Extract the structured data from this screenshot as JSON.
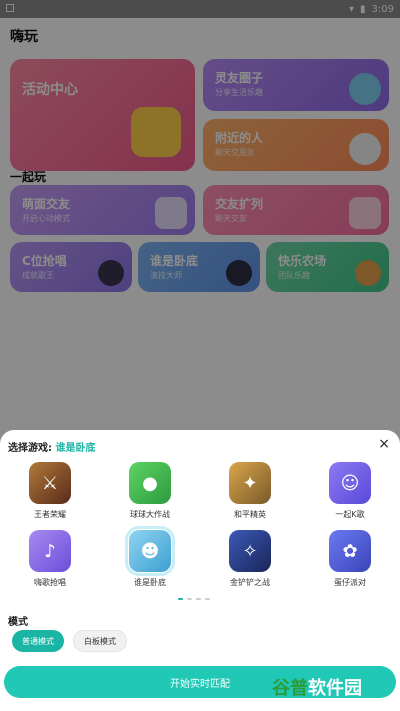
{
  "status": {
    "time": "3:09"
  },
  "page": {
    "title": "嗨玩",
    "section_play": "一起玩",
    "cards": {
      "activity": {
        "title": "活动中心"
      },
      "soul": {
        "title": "灵友圈子",
        "sub": "分享生活乐趣"
      },
      "nearby": {
        "title": "附近的人",
        "sub": "聊天交朋友"
      },
      "voice": {
        "title": "萌面交友",
        "sub": "开启心动模式"
      },
      "expand": {
        "title": "交友扩列",
        "sub": "聊天交友"
      },
      "cpos": {
        "title": "C位抢唱",
        "sub": "成就歌王"
      },
      "spy": {
        "title": "谁是卧底",
        "sub": "演技大师"
      },
      "farm": {
        "title": "快乐农场",
        "sub": "团队乐趣"
      }
    }
  },
  "sheet": {
    "label_prefix": "选择游戏:",
    "selected_game": "谁是卧底",
    "close_icon": "×",
    "games": [
      {
        "label": "王者荣耀",
        "color": "#7a4b2a"
      },
      {
        "label": "球球大作战",
        "color": "#3cb24a"
      },
      {
        "label": "和平精英",
        "color": "#b88a3c"
      },
      {
        "label": "一起K歌",
        "color": "#6a58e8"
      },
      {
        "label": "嗨歌抢唱",
        "color": "#7b5ad9"
      },
      {
        "label": "谁是卧底",
        "color": "#4fb7e2"
      },
      {
        "label": "金铲铲之战",
        "color": "#2a3c8c"
      },
      {
        "label": "蛋仔派对",
        "color": "#4a5ad0"
      }
    ],
    "mode_title": "模式",
    "mode_normal": "普通模式",
    "mode_whiteboard": "白板模式",
    "start_button": "开始实时匹配",
    "watermark_a": "谷普",
    "watermark_b": "软件园"
  }
}
